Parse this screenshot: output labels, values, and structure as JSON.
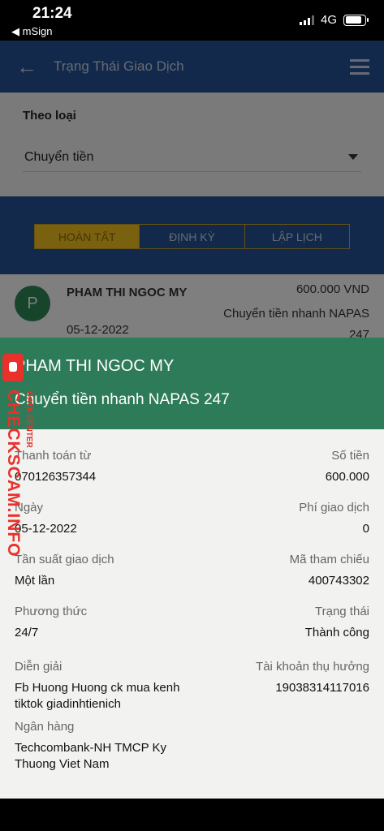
{
  "status_bar": {
    "time": "21:24",
    "back_app": "◀ mSign",
    "network": "4G",
    "battery_level": 0.85
  },
  "app": {
    "header": {
      "title": "Trạng Thái Giao Dịch"
    },
    "filter": {
      "label": "Theo loại",
      "selected": "Chuyển tiền"
    },
    "tabs": [
      "HOÀN TẤT",
      "ĐỊNH KỲ",
      "LẬP LỊCH"
    ],
    "active_tab": "HOÀN TẤT",
    "transaction": {
      "avatar_letter": "P",
      "name": "PHAM THI NGOC MY",
      "date": "05-12-2022",
      "amount": "600.000 VND",
      "description": "Chuyển tiền nhanh NAPAS 247"
    }
  },
  "detail": {
    "recipient_name": "PHAM THI NGOC MY",
    "service": "Chuyển tiền nhanh NAPAS 247",
    "fields": {
      "pay_from": {
        "label": "Thanh toán từ",
        "value": "070126357344"
      },
      "amount": {
        "label": "Số tiền",
        "value": "600.000"
      },
      "date": {
        "label": "Ngày",
        "value": "05-12-2022"
      },
      "fee": {
        "label": "Phí giao dịch",
        "value": "0"
      },
      "frequency": {
        "label": "Tần suất giao dịch",
        "value": "Một lần"
      },
      "reference": {
        "label": "Mã tham chiếu",
        "value": "400743302"
      },
      "method": {
        "label": "Phương thức",
        "value": "24/7"
      },
      "status": {
        "label": "Trạng thái",
        "value": "Thành công"
      },
      "description": {
        "label": "Diễn giải",
        "value": "Fb Huong Huong ck mua kenh tiktok giadinhtienich"
      },
      "beneficiary_account": {
        "label": "Tài khoản thụ hưởng",
        "value": "19038314117016"
      },
      "bank": {
        "label": "Ngân hàng",
        "value": "Techcombank-NH TMCP Ky Thuong Viet Nam"
      }
    }
  },
  "watermark": {
    "text": "CHECKSCAM.INFO",
    "subtext": "DATA CENTER"
  },
  "colors": {
    "header_blue": "#245296",
    "sheet_green": "#2e7b59",
    "tab_active": "#f2c31f",
    "watermark_red": "#e8312a"
  }
}
